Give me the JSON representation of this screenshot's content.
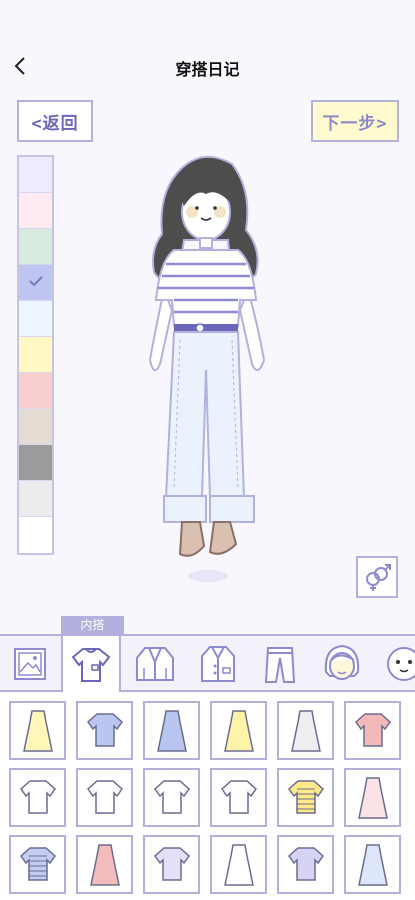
{
  "header": {
    "title": "穿搭日记",
    "back_icon": "chevron-left-icon"
  },
  "buttons": {
    "back_label": "<返回",
    "next_label": "下一步>"
  },
  "palette": {
    "selected_index": 3,
    "colors": [
      "#ececfd",
      "#fdebf1",
      "#d9ebdf",
      "#bdc5f0",
      "#edf5ff",
      "#fff8c4",
      "#f8cfcf",
      "#e4dcd2",
      "#9b9b9b",
      "#ececec",
      "#ffffff"
    ]
  },
  "gender_icon": "gender-symbol-icon",
  "category": {
    "active_label": "内搭",
    "tabs": [
      "photo-icon",
      "tshirt-icon",
      "jacket-icon",
      "coat-icon",
      "pants-icon",
      "hair-icon",
      "face-icon"
    ]
  },
  "clothing_items": [
    "yellow-dress-icon",
    "blue-shirt-icon",
    "blue-pinafore-icon",
    "yellow-ruffle-dress-icon",
    "grey-dress-icon",
    "pink-blouse-icon",
    "sailor-top-icon",
    "white-tie-shirt-icon",
    "white-shirt-icon",
    "white-camisole-icon",
    "yellow-striped-top-icon",
    "pink-collar-dress-icon",
    "blue-striped-top-icon",
    "pink-dress-icon",
    "lavender-top-icon",
    "white-long-dress-icon",
    "purple-crop-top-icon",
    "blue-shirt-dress-icon"
  ]
}
